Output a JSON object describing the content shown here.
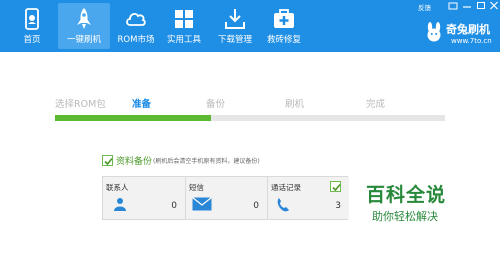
{
  "toolbar": {
    "items": [
      {
        "label": "首页",
        "icon": "phone-home-icon"
      },
      {
        "label": "一键刷机",
        "icon": "rocket-icon"
      },
      {
        "label": "ROM市场",
        "icon": "cloud-icon"
      },
      {
        "label": "实用工具",
        "icon": "grid-icon"
      },
      {
        "label": "下载管理",
        "icon": "download-icon"
      },
      {
        "label": "救砖修复",
        "icon": "medkit-icon"
      }
    ],
    "active_item": "一键刷机",
    "feedback_label": "反馈",
    "brand_name": "奇兔刷机",
    "brand_url": "www.7to.cn"
  },
  "steps": {
    "items": [
      "选择ROM包",
      "准备",
      "备份",
      "刷机",
      "完成"
    ],
    "current": "准备",
    "progress_fraction": 0.4
  },
  "backup": {
    "checked": true,
    "label": "资料备份",
    "note": "(刷机后会清空手机原有资料，建议备份)",
    "items": [
      {
        "title": "联系人",
        "count": "0",
        "icon": "contact-person-icon",
        "checked": false
      },
      {
        "title": "短信",
        "count": "0",
        "icon": "envelope-icon",
        "checked": false
      },
      {
        "title": "通话记录",
        "count": "3",
        "icon": "phone-handset-icon",
        "checked": true
      }
    ]
  },
  "watermark": {
    "title": "百科全说",
    "subtitle": "助你轻松解决"
  },
  "colors": {
    "toolbar_bg": "#1f8fe6",
    "active_step": "#1a8be6",
    "progress": "#5cb932",
    "watermark": "#27893a"
  }
}
